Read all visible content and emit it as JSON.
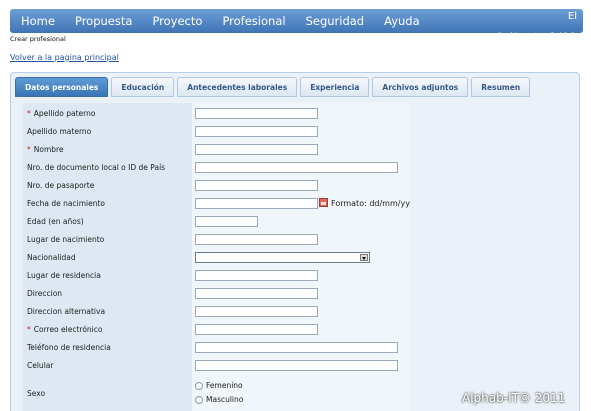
{
  "nav": {
    "items": [
      "Home",
      "Propuesta",
      "Proyecto",
      "Profesional",
      "Seguridad",
      "Ayuda"
    ],
    "user_name": "El",
    "change_password": "Cambiar contraseña",
    "separator": "|",
    "logout": "Salir"
  },
  "page": {
    "title": "Crear profesional",
    "back_link": "Volver a la pagina principal"
  },
  "tabs": [
    "Datos personales",
    "Educación",
    "Antecedentes laborales",
    "Experiencia",
    "Archivos adjuntos",
    "Resumen"
  ],
  "active_tab": "Datos personales",
  "form": {
    "required_marker": "*",
    "fields": [
      {
        "label": "Apellido paterno",
        "required": true,
        "value": ""
      },
      {
        "label": "Apellido materno",
        "required": false,
        "value": ""
      },
      {
        "label": "Nombre",
        "required": true,
        "value": ""
      },
      {
        "label": "Nro. de documento local o ID de País",
        "required": false,
        "value": ""
      },
      {
        "label": "Nro. de pasaporte",
        "required": false,
        "value": ""
      },
      {
        "label": "Fecha de nacimiento",
        "required": false,
        "value": ""
      },
      {
        "label": "Edad (en años)",
        "required": false,
        "value": ""
      },
      {
        "label": "Lugar de nacimiento",
        "required": false,
        "value": ""
      },
      {
        "label": "Nacionalidad",
        "required": false,
        "value": ""
      },
      {
        "label": "Lugar de residencia",
        "required": false,
        "value": ""
      },
      {
        "label": "Direccion",
        "required": false,
        "value": ""
      },
      {
        "label": "Direccion alternativa",
        "required": false,
        "value": ""
      },
      {
        "label": "Correo electrónico",
        "required": true,
        "value": ""
      },
      {
        "label": "Teléfono de residencia",
        "required": false,
        "value": ""
      },
      {
        "label": "Celular",
        "required": false,
        "value": ""
      },
      {
        "label": "Sexo",
        "required": false,
        "value": ""
      }
    ],
    "date_format": "Formato: dd/mm/yy",
    "sex_options": [
      "Femenino",
      "Masculino"
    ]
  },
  "watermark": "Alphab-IT© 2011",
  "colors": {
    "nav_bar": "#3f73b5",
    "active_tab": "#3974b6",
    "label_column": "#dde8f3",
    "required": "#cc2222",
    "link": "#2255aa"
  },
  "icons": [
    "calendar-icon",
    "dropdown-arrow-icon"
  ]
}
